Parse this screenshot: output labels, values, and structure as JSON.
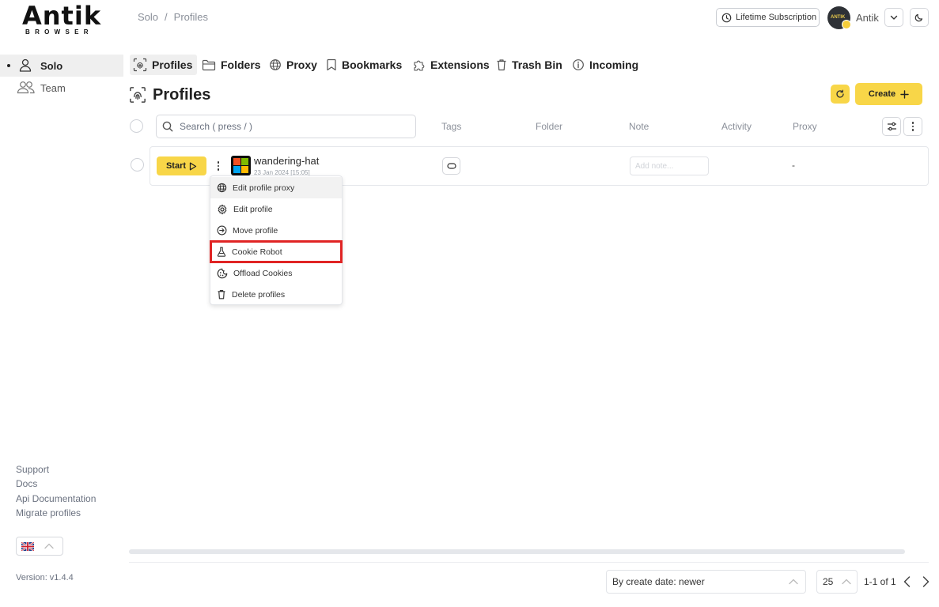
{
  "brand": {
    "logo_word": "Antik",
    "logo_sub": "BROWSER"
  },
  "breadcrumb": {
    "root": "Solo",
    "separator": "/",
    "current": "Profiles"
  },
  "header": {
    "lifetime_label": "Lifetime Subscription",
    "avatar_label": "ANTIK",
    "user_name": "Antik"
  },
  "sidebar": {
    "workspaces": [
      {
        "label": "Solo",
        "icon": "person-icon",
        "active": true
      },
      {
        "label": "Team",
        "icon": "people-icon",
        "active": false
      }
    ],
    "links": [
      "Support",
      "Docs",
      "Api Documentation",
      "Migrate profiles"
    ],
    "language": "EN (UK flag)",
    "version": "Version: v1.4.4"
  },
  "tabs": [
    {
      "label": "Profiles",
      "icon": "fingerprint-icon",
      "active": true
    },
    {
      "label": "Folders",
      "icon": "folder-icon"
    },
    {
      "label": "Proxy",
      "icon": "globe-icon"
    },
    {
      "label": "Bookmarks",
      "icon": "bookmark-icon"
    },
    {
      "label": "Extensions",
      "icon": "puzzle-icon"
    },
    {
      "label": "Trash Bin",
      "icon": "trash-icon"
    },
    {
      "label": "Incoming",
      "icon": "info-icon"
    }
  ],
  "page": {
    "title": "Profiles",
    "create_label": "Create"
  },
  "search": {
    "placeholder": "Search ( press / )",
    "value": ""
  },
  "columns": {
    "tags": "Tags",
    "folder": "Folder",
    "note": "Note",
    "activity": "Activity",
    "proxy": "Proxy"
  },
  "profiles": [
    {
      "start_label": "Start",
      "os_icon": "windows-icon",
      "name": "wandering-hat",
      "date": "23 Jan 2024 [15:05]",
      "note_placeholder": "Add note...",
      "activity": "",
      "proxy": "-"
    }
  ],
  "context_menu": {
    "items": [
      {
        "label": "Edit profile proxy",
        "icon": "globe-icon",
        "hover": true
      },
      {
        "label": "Edit profile",
        "icon": "gear-icon"
      },
      {
        "label": "Move profile",
        "icon": "arrow-circle-icon"
      },
      {
        "label": "Cookie Robot",
        "icon": "flask-icon",
        "highlighted": true
      },
      {
        "label": "Offload Cookies",
        "icon": "cookie-icon"
      },
      {
        "label": "Delete profiles",
        "icon": "trash-icon"
      }
    ]
  },
  "footer": {
    "sort_value": "By create date: newer",
    "per_page": "25",
    "page_info": "1-1 of 1"
  },
  "colors": {
    "accent": "#f8d648",
    "highlight_border": "#e02424",
    "active_bg": "#efefef"
  }
}
